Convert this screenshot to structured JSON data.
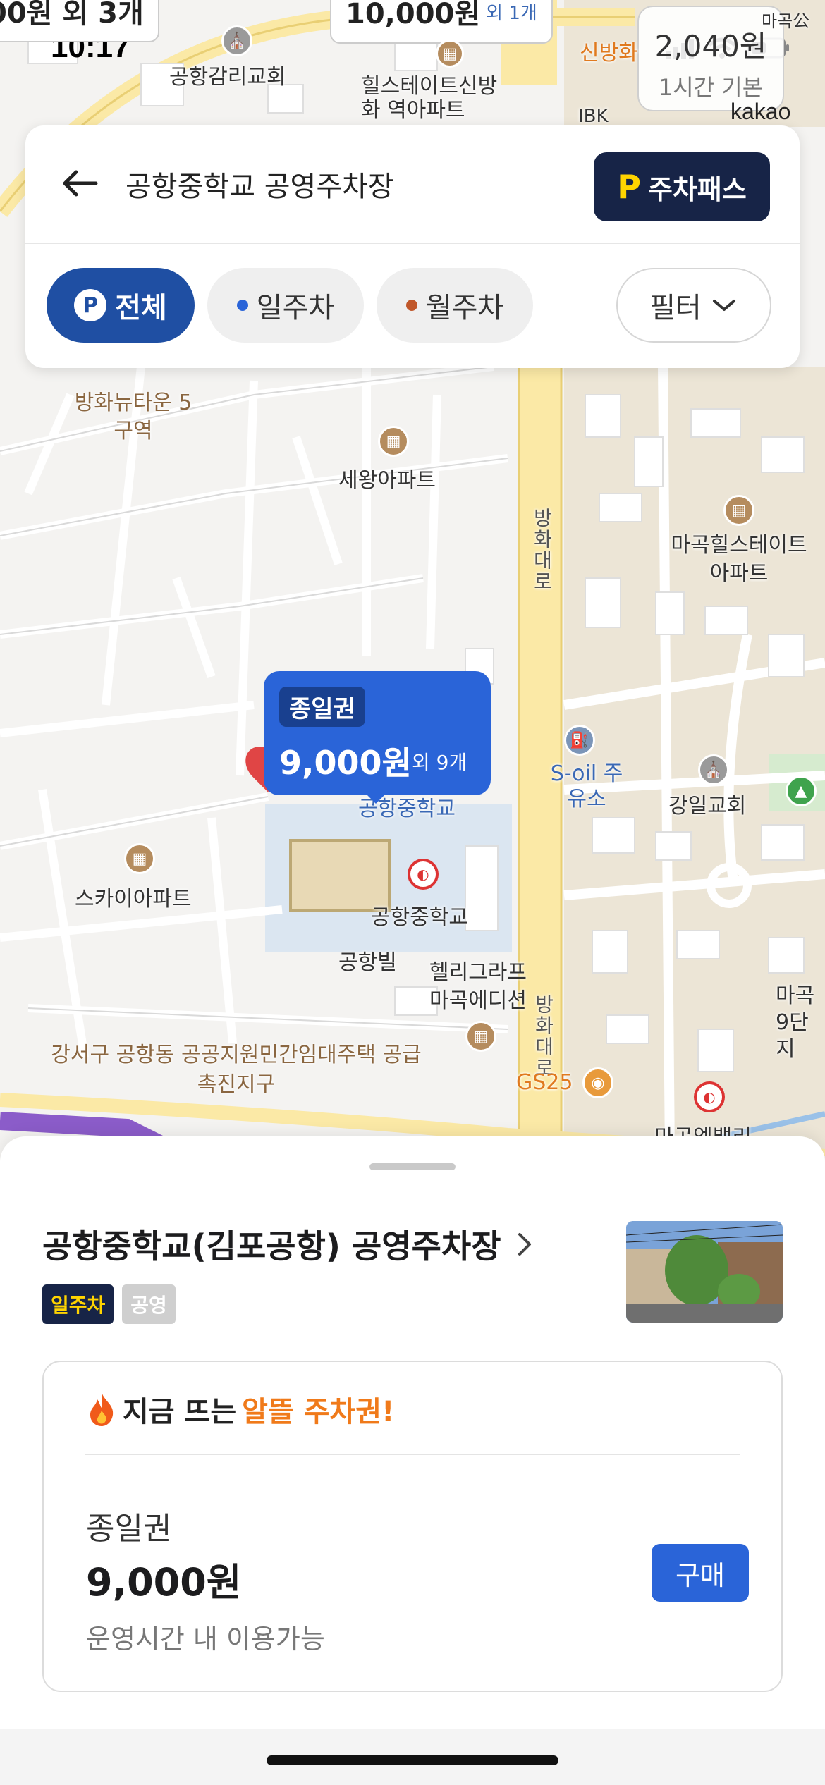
{
  "status": {
    "time": "10:17"
  },
  "map": {
    "price_chip": {
      "price": "2,040원",
      "desc": "1시간 기본"
    },
    "top_bubble": {
      "price": "10,000원",
      "more": "외 1개"
    },
    "corner_label": "00원 외 3개",
    "provider": "kakao",
    "labels": {
      "church1": "공항감리교회",
      "apt_hillstate": "힐스테이트신방화 역아파트",
      "banghwa_newtown": "방화뉴타운 5구역",
      "sewang": "세왕아파트",
      "magok_hill": "마곡힐스테이트 아파트",
      "road": "방화대로",
      "road2": "방화대로",
      "soil": "S-oil 주유소",
      "gangil": "강일교회",
      "sky": "스카이아파트",
      "school_label": "공항중학교",
      "school_top": "공항중학교",
      "gonghangbil": "공항빌",
      "helli": "헬리그라프 마곡에디션",
      "gangseo": "강서구 공항동 공공지원민간임대주택 공급촉진지구",
      "gs25": "GS25",
      "magok_elbeli": "마곡엠밸리",
      "magok_9": "마곡 9단지",
      "sinbang": "신방화",
      "ibk": "IBK",
      "magok_top": "마곡公"
    },
    "bubble": {
      "tag": "종일권",
      "price": "9,000원",
      "more": "외 9개"
    }
  },
  "search": {
    "query": "공항중학교 공영주차장",
    "pass_label": "주차패스",
    "pass_icon": "P"
  },
  "filters": {
    "all": "전체",
    "day": "일주차",
    "month": "월주차",
    "filter": "필터",
    "day_color": "#2a64d8",
    "month_color": "#c0572a"
  },
  "sheet": {
    "title": "공항중학교(김포공항) 공영주차장",
    "tags": [
      "일주차",
      "공영"
    ],
    "promo_prefix": "지금 뜨는 ",
    "promo_accent": "알뜰 주차권!",
    "ticket": {
      "name": "종일권",
      "price": "9,000원",
      "note": "운영시간 내 이용가능",
      "buy": "구매"
    }
  }
}
